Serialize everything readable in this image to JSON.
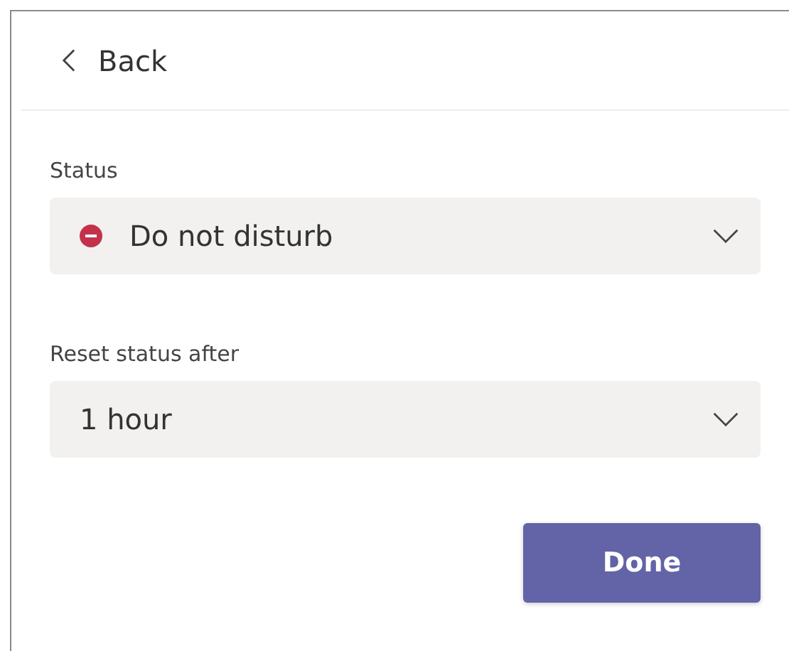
{
  "header": {
    "back_label": "Back"
  },
  "fields": [
    {
      "label": "Status",
      "value": "Do not disturb",
      "kind": "status"
    },
    {
      "label": "Reset status after",
      "value": "1 hour",
      "kind": "plain"
    }
  ],
  "primary_button": "Done"
}
